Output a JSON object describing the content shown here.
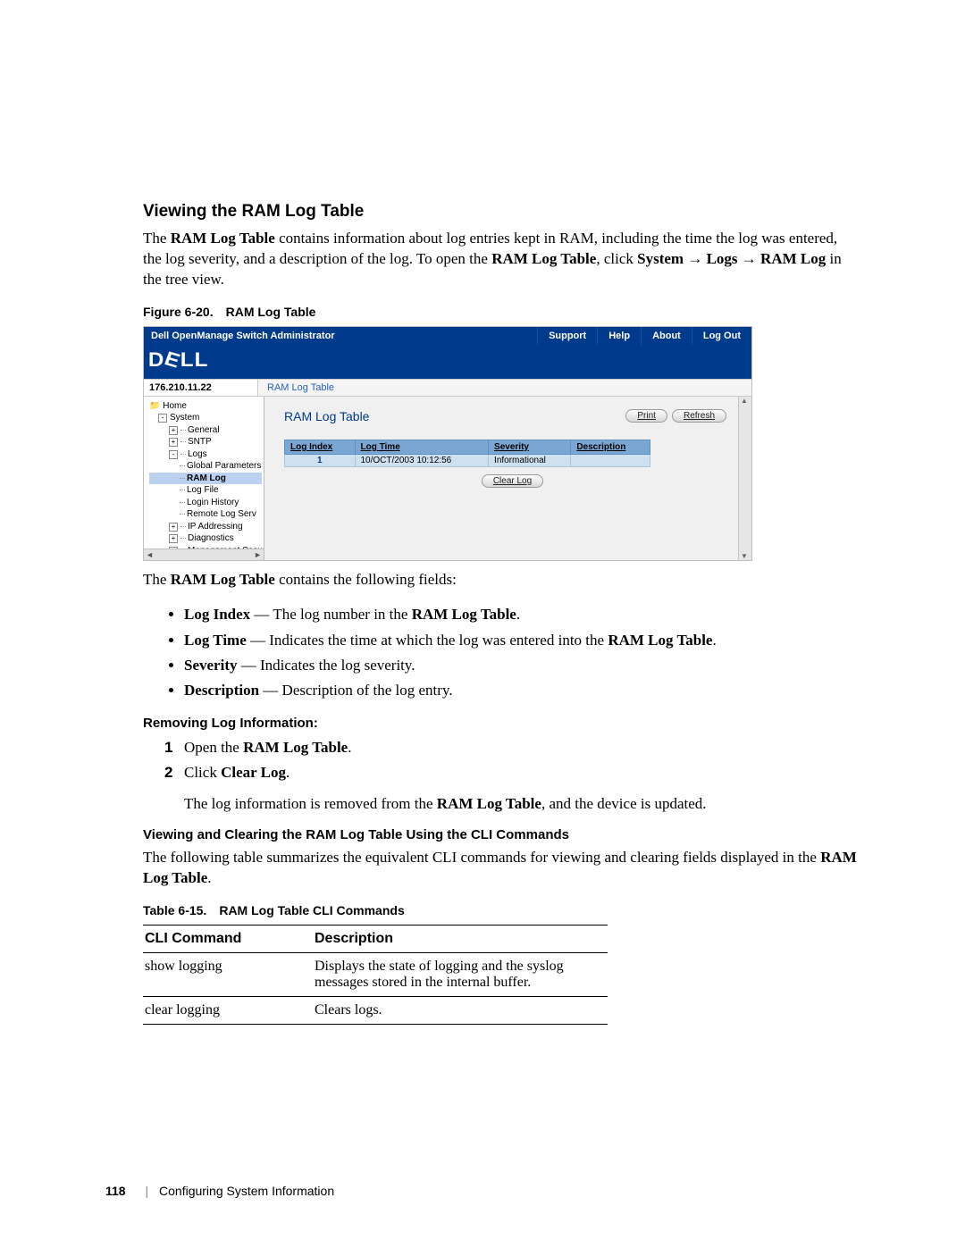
{
  "section_title": "Viewing the RAM Log Table",
  "intro_parts": [
    "The ",
    "RAM Log Table",
    " contains information about log entries kept in RAM, including the time the log was entered, the log severity, and a description of the log. To open the ",
    "RAM Log Table",
    ", click ",
    "System",
    " → ",
    "Logs",
    " → ",
    "RAM Log",
    " in the tree view."
  ],
  "figure_caption_label": "Figure 6-20.",
  "figure_caption_text": "RAM Log Table",
  "ui": {
    "titlebar": {
      "title": "Dell OpenManage Switch Administrator",
      "links": [
        "Support",
        "Help",
        "About",
        "Log Out"
      ]
    },
    "ip": "176.210.11.22",
    "breadcrumb": "RAM Log Table",
    "tree": {
      "home": "Home",
      "system": "System",
      "general": "General",
      "sntp": "SNTP",
      "logs": "Logs",
      "global_params": "Global Parameters",
      "ram_log": "RAM Log",
      "log_file": "Log File",
      "login_history": "Login History",
      "remote_log_serv": "Remote Log Serv",
      "ip_addressing": "IP Addressing",
      "diagnostics": "Diagnostics",
      "mgmt_security": "Management Security"
    },
    "panel_title": "RAM Log Table",
    "buttons": {
      "print": "Print",
      "refresh": "Refresh",
      "clear": "Clear Log"
    },
    "table": {
      "headers": [
        "Log Index",
        "Log Time",
        "Severity",
        "Description"
      ],
      "rows": [
        {
          "index": "1",
          "time": "10/OCT/2003 10:12:56",
          "severity": "Informational",
          "description": ""
        }
      ]
    }
  },
  "fields_intro_parts": [
    "The ",
    "RAM Log Table",
    " contains the following fields:"
  ],
  "fields": [
    {
      "term": "Log Index",
      "rest": " — The log number in the ",
      "bold2": "RAM Log Table",
      "tail": "."
    },
    {
      "term": "Log Time",
      "rest": " — Indicates the time at which the log was entered into the ",
      "bold2": "RAM Log Table",
      "tail": "."
    },
    {
      "term": "Severity",
      "rest": " — Indicates the log severity.",
      "bold2": "",
      "tail": ""
    },
    {
      "term": "Description",
      "rest": " — Description of the log entry.",
      "bold2": "",
      "tail": ""
    }
  ],
  "removing_heading": "Removing Log Information:",
  "steps": [
    {
      "n": "1",
      "pre": "Open the ",
      "bold": "RAM Log Table",
      "post": "."
    },
    {
      "n": "2",
      "pre": "Click ",
      "bold": "Clear Log",
      "post": "."
    }
  ],
  "step_followup_parts": [
    "The log information is removed from the ",
    "RAM Log Table",
    ", and the device is updated."
  ],
  "cli_heading": "Viewing and Clearing the RAM Log Table Using the CLI Commands",
  "cli_intro_parts": [
    "The following table summarizes the equivalent CLI commands for viewing and clearing fields displayed in the ",
    "RAM Log Table",
    "."
  ],
  "cli_caption_label": "Table 6-15.",
  "cli_caption_text": "RAM Log Table CLI Commands",
  "cli_table": {
    "headers": [
      "CLI Command",
      "Description"
    ],
    "rows": [
      {
        "cmd": "show logging",
        "desc": "Displays the state of logging and the syslog messages stored in the internal buffer."
      },
      {
        "cmd": "clear logging",
        "desc": "Clears logs."
      }
    ]
  },
  "footer": {
    "page": "118",
    "section": "Configuring System Information"
  }
}
